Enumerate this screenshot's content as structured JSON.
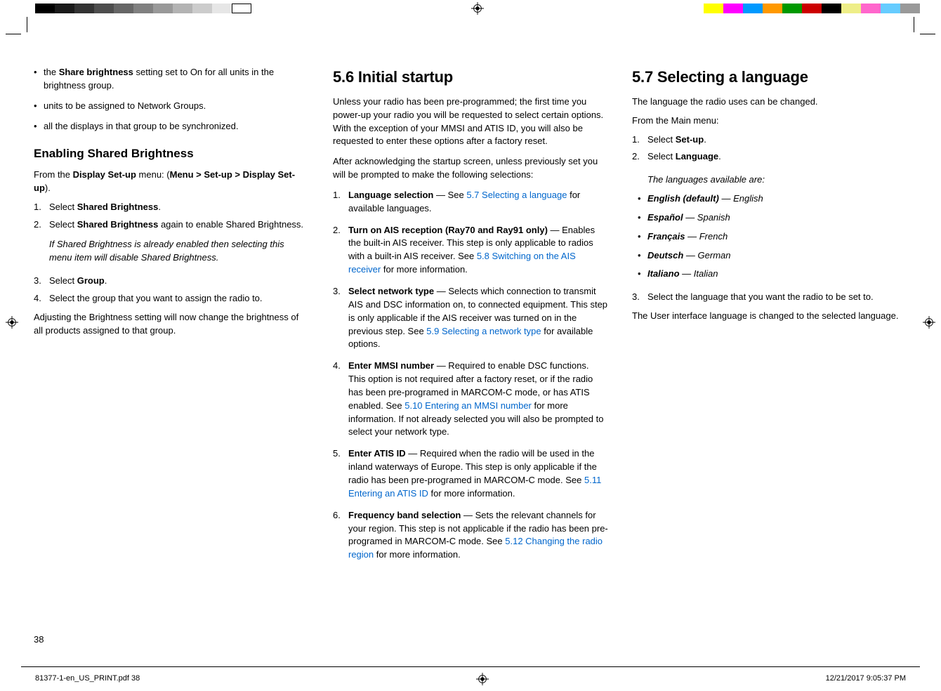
{
  "col1": {
    "bullets": [
      {
        "pre": "the ",
        "b": "Share brightness",
        "post": " setting set to On for all units in the brightness group."
      },
      {
        "pre": "",
        "b": "",
        "post": "units to be assigned to Network Groups."
      },
      {
        "pre": "",
        "b": "",
        "post": "all the displays in that group to be synchronized."
      }
    ],
    "h3": "Enabling Shared Brightness",
    "intro_pre": "From the ",
    "intro_b1": "Display Set-up",
    "intro_mid": " menu: (",
    "intro_b2": "Menu > Set-up > Display Set-up",
    "intro_post": ").",
    "step1_pre": "Select ",
    "step1_b": "Shared Brightness",
    "step1_post": ".",
    "step2_pre": "Select ",
    "step2_b": "Shared Brightness",
    "step2_post": " again to enable Shared Brightness.",
    "note": "If Shared Brightness is already enabled then selecting this menu item will disable Shared Brightness.",
    "step3_pre": "Select ",
    "step3_b": "Group",
    "step3_post": ".",
    "step4": "Select the group that you want to assign the radio to.",
    "closing": "Adjusting the Brightness setting will now change the brightness of all products assigned to that group."
  },
  "col2": {
    "h2": "5.6 Initial startup",
    "p1": "Unless your radio has been pre-programmed; the first time you power-up your radio you will be requested to select certain options. With the exception of your MMSI and ATIS ID, you will also be requested to enter these options after a factory reset.",
    "p2": "After acknowledging the startup screen, unless previously set you will be prompted to make the following selections:",
    "s1_b": "Language selection",
    "s1_mid1": " — See ",
    "s1_link": "5.7 Selecting a language",
    "s1_post": " for available languages.",
    "s2_b": "Turn on AIS reception (Ray70 and Ray91 only)",
    "s2_mid1": " — Enables the built-in AIS receiver. This step is only applicable to radios with a built-in AIS receiver. See ",
    "s2_link": "5.8 Switching on the AIS receiver",
    "s2_post": " for more information.",
    "s3_b": "Select network type",
    "s3_mid1": " — Selects which connection to transmit AIS and DSC information on, to connected equipment. This step is only applicable if the AIS receiver was turned on in the previous step. See ",
    "s3_link": "5.9 Selecting a network type",
    "s3_post": " for available options.",
    "s4_b": "Enter MMSI number",
    "s4_mid1": " — Required to enable DSC functions. This option is not required after a factory reset, or if the radio has been pre-programed in MARCOM-C mode, or has ATIS enabled. See ",
    "s4_link": "5.10 Entering an MMSI number",
    "s4_post": " for more information. If not already selected you will also be prompted to select your network type.",
    "s5_b": "Enter ATIS ID",
    "s5_mid1": " — Required when the radio will be used in the inland waterways of Europe. This step is only applicable if the radio has been pre-programed in MARCOM-C mode. See ",
    "s5_link": "5.11 Entering an ATIS ID",
    "s5_post": " for more information.",
    "s6_b": "Frequency band selection",
    "s6_mid1": " — Sets the relevant channels for your region. This step is not applicable if the radio has been pre-programed in MARCOM-C mode. See ",
    "s6_link": "5.12 Changing the radio region",
    "s6_post": " for more information."
  },
  "col3": {
    "h2": "5.7 Selecting a language",
    "p1": "The language the radio uses can be changed.",
    "p2": "From the Main menu:",
    "step1_pre": "Select ",
    "step1_b": "Set-up",
    "step1_post": ".",
    "step2_pre": "Select ",
    "step2_b": "Language",
    "step2_post": ".",
    "lang_intro": "The languages available are:",
    "langs": [
      {
        "b": "English (default)",
        "rest": " — English"
      },
      {
        "b": "Español",
        "rest": " — Spanish"
      },
      {
        "b": "Français",
        "rest": " — French"
      },
      {
        "b": "Deutsch",
        "rest": " — German"
      },
      {
        "b": "Italiano",
        "rest": " — Italian"
      }
    ],
    "step3": "Select the language that you want the radio to be set to.",
    "closing": "The User interface language is changed to the selected language."
  },
  "pagenum": "38",
  "footer_left": "81377-1-en_US_PRINT.pdf   38",
  "footer_right": "12/21/2017   9:05:37 PM"
}
